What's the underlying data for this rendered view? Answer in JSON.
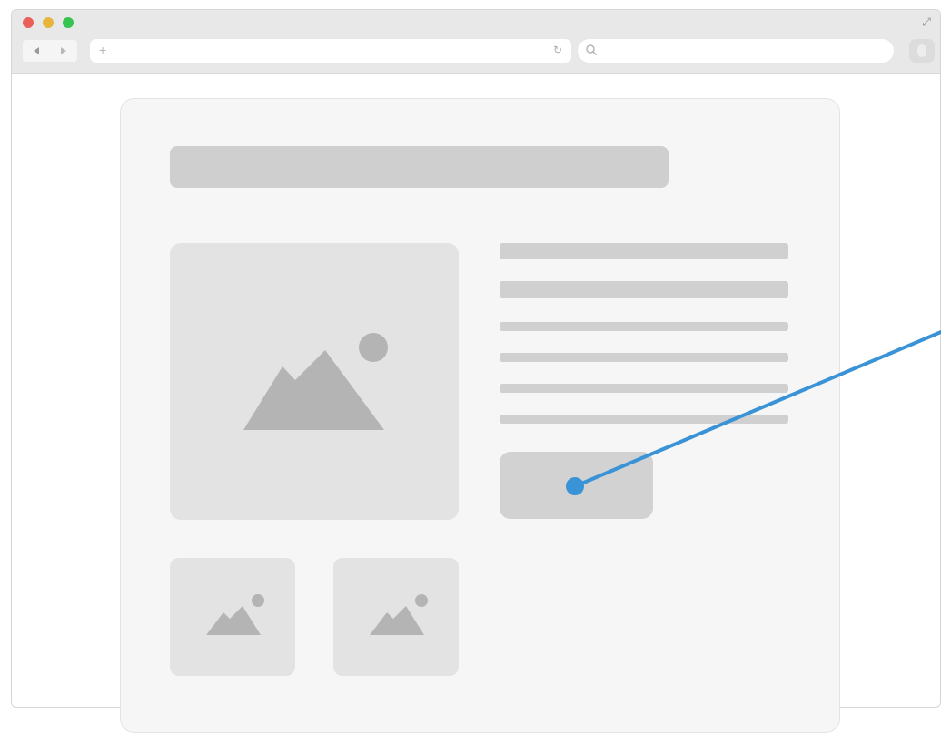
{
  "browser": {
    "window_controls": [
      "close",
      "minimize",
      "maximize"
    ],
    "nav": {
      "back_icon": "back-arrow-icon",
      "forward_icon": "forward-arrow-icon"
    },
    "address": {
      "value": "",
      "placeholder": ""
    },
    "search": {
      "value": "",
      "placeholder": ""
    }
  },
  "page": {
    "title_placeholder": "",
    "text_lines": 6,
    "thumbnail_count": 2
  },
  "annotation": {
    "target": "cta-button",
    "color": "#3a93d6"
  },
  "colors": {
    "close": "#ea5f58",
    "minimize": "#e7b43c",
    "maximize": "#36c351",
    "placeholder": "#cfcfcf",
    "image_bg": "#e3e3e3",
    "image_shape": "#b4b4b4",
    "pointer": "#3a93d6"
  }
}
